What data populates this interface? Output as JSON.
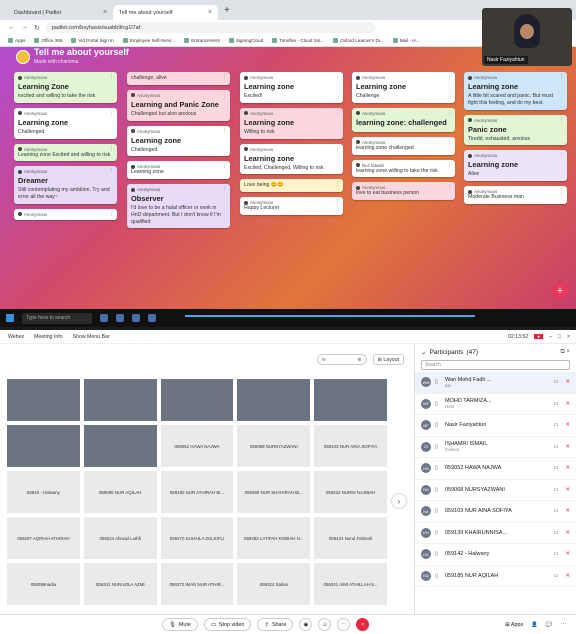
{
  "browser": {
    "tabs": [
      {
        "label": "Dashboard | Padlet",
        "active": false
      },
      {
        "label": "Tell me about yourself",
        "active": true
      }
    ],
    "url": "padlet.com/bsyhasis/suabb9lcg1l7af",
    "bookmarks": [
      "Apps",
      "Office 365",
      "Vid Portal Sign In",
      "Employee Self-Servi...",
      "Entrancement",
      "SigningCloud",
      "Timeflex - Cloud Sol...",
      "Oxford Learner's Di...",
      "Mail - H..."
    ]
  },
  "padlet": {
    "title": "Tell me about yourself",
    "subtitle": "Made with charisma",
    "columns": [
      [
        {
          "author": "Anonymous",
          "title": "Learning Zone",
          "body": "excited and willing to take the risk",
          "color": "green"
        },
        {
          "author": "Anonymous",
          "title": "Learning zone",
          "body": "Challenged",
          "color": "white"
        },
        {
          "author": "Anonymous",
          "title": "",
          "body": "Learning zone Excited and willing to risk",
          "color": "green"
        },
        {
          "author": "Anonymous",
          "title": "Dreamer",
          "body": "Still contemplating my ambition. Try and error all the way~",
          "color": "purple"
        },
        {
          "author": "Anonymous",
          "title": "",
          "body": "",
          "color": "white"
        }
      ],
      [
        {
          "author": "",
          "title": "",
          "body": "challenge, alive",
          "color": "pink"
        },
        {
          "author": "Anonymous",
          "title": "Learning and Panic Zone",
          "body": "Challenged but also anxious",
          "color": "pink"
        },
        {
          "author": "Anonymous",
          "title": "Learning zone",
          "body": "Challenged",
          "color": "white"
        },
        {
          "author": "Anonymous",
          "title": "",
          "body": "Learning zone",
          "color": "white"
        },
        {
          "author": "Anonymous",
          "title": "Observer",
          "body": "I'd love to be a halal officer or work in HnD department. But I don't know if I'm qualified",
          "color": "purple"
        }
      ],
      [
        {
          "author": "Anonymous",
          "title": "Learning zone",
          "body": "Excited!",
          "color": "white"
        },
        {
          "author": "Anonymous",
          "title": "Learning zone",
          "body": "Willing to risk",
          "color": "pink"
        },
        {
          "author": "Anonymous",
          "title": "Learning zone",
          "body": "Excited, Challenged, Willing to risk",
          "color": "white"
        },
        {
          "author": "",
          "title": "",
          "body": "Love being 😊😊",
          "color": "yellow"
        },
        {
          "author": "Anonymous",
          "title": "",
          "body": "Happy Lecturer",
          "color": "white"
        }
      ],
      [
        {
          "author": "Anonymous",
          "title": "Learning zone",
          "body": "Challenge",
          "color": "white"
        },
        {
          "author": "Anonymous",
          "title": "learning zone: challenged",
          "body": "",
          "color": "green"
        },
        {
          "author": "Anonymous",
          "title": "",
          "body": "learning zone challenged",
          "color": "white"
        },
        {
          "author": "Nuz fatwah",
          "title": "",
          "body": "learning zone willing to take the risk",
          "color": "white"
        },
        {
          "author": "Anonymous",
          "title": "",
          "body": "love to eat business person",
          "color": "pink"
        }
      ],
      [
        {
          "author": "Anonymous",
          "title": "Learning zone",
          "body": "A little bit scared and panic. But must fight this feeling, and do my best.",
          "color": "blue"
        },
        {
          "author": "Anonymous",
          "title": "Panic zone",
          "body": "Tiredd, exhausted, anxious",
          "color": "green"
        },
        {
          "author": "Anonymous",
          "title": "Learning zone",
          "body": "Alive",
          "color": "lav"
        },
        {
          "author": "Anonymous",
          "title": "",
          "body": "Moderate Business man",
          "color": "white"
        }
      ]
    ]
  },
  "pip": {
    "name": "Nasir Faziyahtun"
  },
  "taskbar": {
    "search_placeholder": "Type here to search"
  },
  "meeting": {
    "header": {
      "webex": "Webex",
      "meeting_info": "Meeting Info",
      "show_menu": "Show Menu Bar",
      "time": "02:13:52"
    },
    "layout_label": "Layout",
    "tiles": [
      "",
      "",
      "",
      "",
      "",
      "",
      "",
      "059052 HAWA NAJWA",
      "059068 NURSYAZWANI",
      "059103 NUR AINA SOFIYA",
      "55940 - Halwany",
      "059085 NUR AQILAH",
      "059180 NUR ATHIRAH BI...",
      "059286 NUR SHAHIRAH BI...",
      "059222 NURIN NAJIBAH",
      "059297 AQIRAH ATHIRAH",
      "059224 Ahmad Luthfi",
      "059270 SUHAILA ZULKIFLI",
      "059282 LATIFAH ROBIAH N...",
      "059424 Nurul Fatimah",
      "059359nadia",
      "059341 NURAZILA AZMI",
      "059373 IMAN NUR ATHIR...",
      "059324 Salina",
      "059341 AIMI ATHILLAH S..."
    ],
    "participants": {
      "title": "Participants",
      "count": "(47)",
      "search_placeholder": "Search",
      "list": [
        {
          "initials": "WM",
          "name": "Wan Mohd Fadli ...",
          "role": "Me"
        },
        {
          "initials": "MT",
          "name": "MOHD TARMIZA...",
          "role": "Host"
        },
        {
          "initials": "NF",
          "name": "Nasir Faziyahtun",
          "role": ""
        },
        {
          "initials": "IS",
          "name": "ISHAMRI ISMAIL",
          "role": "Cohost"
        },
        {
          "initials": "HN",
          "name": "059052 HAWA NAJWA",
          "role": ""
        },
        {
          "initials": "NS",
          "name": "059068 NURSYAZWANI",
          "role": ""
        },
        {
          "initials": "NA",
          "name": "059103 NUR AINA SOFIYA",
          "role": ""
        },
        {
          "initials": "KH",
          "name": "059139 KHAIRUNNISA...",
          "role": ""
        },
        {
          "initials": "HA",
          "name": "059142 - Halwany",
          "role": ""
        },
        {
          "initials": "NQ",
          "name": "059185 NUR AQILAH",
          "role": ""
        }
      ]
    },
    "toolbar": {
      "mute": "Mute",
      "stop_video": "Stop video",
      "share": "Share",
      "apps": "Apps"
    }
  }
}
